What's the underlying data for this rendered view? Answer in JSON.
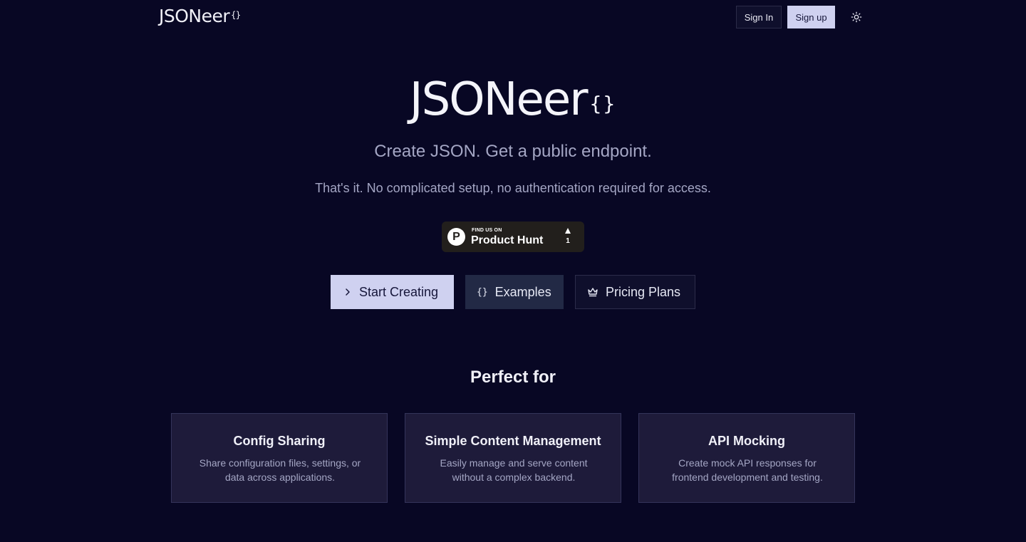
{
  "header": {
    "logo_text": "JSONeer",
    "logo_brace": "{}",
    "signin_label": "Sign In",
    "signup_label": "Sign up",
    "theme_icon": "sun-icon"
  },
  "hero": {
    "title": "JSONeer",
    "title_brace": "{}",
    "tagline": "Create JSON. Get a public endpoint.",
    "subline": "That's it. No complicated setup, no authentication required for access."
  },
  "product_hunt": {
    "find_text": "FIND US ON",
    "name": "Product Hunt",
    "logo_letter": "P",
    "upvotes": "1"
  },
  "cta": {
    "start_label": "Start Creating",
    "examples_label": "Examples",
    "examples_icon_text": "{}",
    "pricing_label": "Pricing Plans"
  },
  "perfect_for": {
    "title": "Perfect for",
    "cards": [
      {
        "title": "Config Sharing",
        "desc": "Share configuration files, settings, or data across applications."
      },
      {
        "title": "Simple Content Management",
        "desc": "Easily manage and serve content without a complex backend."
      },
      {
        "title": "API Mocking",
        "desc": "Create mock API responses for frontend development and testing."
      }
    ]
  },
  "colors": {
    "background": "#080724",
    "primary_button": "#cfd1f0",
    "card_background": "#1e1b3a",
    "muted_text": "#a4a6c4"
  }
}
